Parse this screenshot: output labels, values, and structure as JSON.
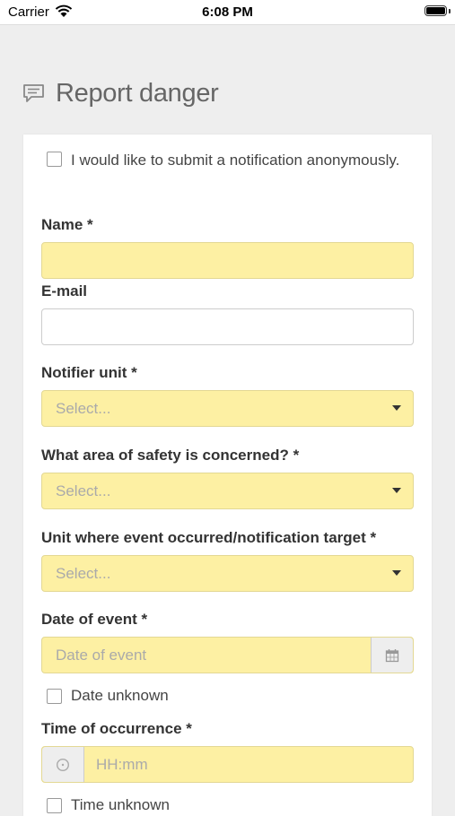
{
  "status_bar": {
    "carrier": "Carrier",
    "time": "6:08 PM"
  },
  "page": {
    "title": "Report danger"
  },
  "form": {
    "anonymous_label": "I would like to submit a notification anonymously.",
    "name_label": "Name *",
    "name_value": "",
    "email_label": "E-mail",
    "email_value": "",
    "notifier_unit_label": "Notifier unit *",
    "notifier_unit_value": "Select...",
    "safety_area_label": "What area of safety is concerned? *",
    "safety_area_value": "Select...",
    "event_unit_label": "Unit where event occurred/notification target *",
    "event_unit_value": "Select...",
    "date_label": "Date of event *",
    "date_placeholder": "Date of event",
    "date_unknown_label": "Date unknown",
    "time_label": "Time of occurrence *",
    "time_placeholder": "HH:mm",
    "time_unknown_label": "Time unknown"
  },
  "colors": {
    "required_field_bg": "#fdf0a3",
    "background": "#eeeeee",
    "card": "#ffffff"
  },
  "icons": [
    "wifi-icon",
    "battery-icon",
    "comment-icon",
    "caret-down-icon",
    "calendar-icon",
    "clock-icon"
  ]
}
